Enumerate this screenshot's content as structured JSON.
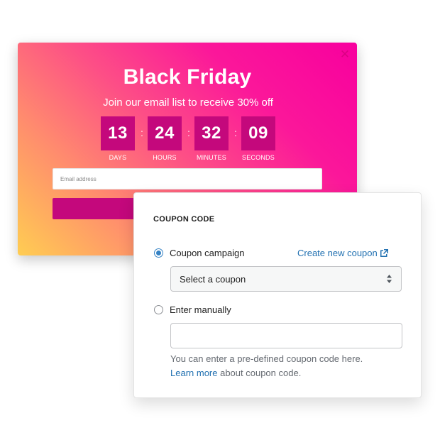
{
  "popup": {
    "title": "Black Friday",
    "subtitle": "Join our email list to receive 30% off",
    "close_icon": "close-icon",
    "countdown": [
      {
        "value": "13",
        "label": "DAYS"
      },
      {
        "value": "24",
        "label": "HOURS"
      },
      {
        "value": "32",
        "label": "MINUTES"
      },
      {
        "value": "09",
        "label": "SECONDS"
      }
    ],
    "separator": ":",
    "email_placeholder": "Email address",
    "colors": {
      "gradient_start": "#ffcd52",
      "gradient_end": "#f8009e",
      "accent": "#c4087c"
    }
  },
  "coupon": {
    "heading": "COUPON CODE",
    "campaign_label": "Coupon campaign",
    "campaign_selected": true,
    "create_link": "Create new coupon",
    "create_link_icon": "external-link-icon",
    "select_value": "Select a coupon",
    "select_icon": "select-arrows-icon",
    "manual_label": "Enter manually",
    "manual_selected": false,
    "manual_value": "",
    "help_text": "You can enter a pre-defined coupon code here.",
    "learn_more": "Learn more",
    "learn_more_suffix": " about coupon code.",
    "colors": {
      "link": "#2271b1",
      "radio_checked": "#3582c4"
    }
  }
}
